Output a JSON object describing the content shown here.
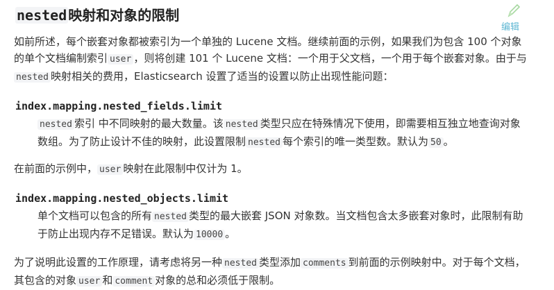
{
  "title": {
    "code": "nested",
    "text": "映射和对象的限制"
  },
  "edit_label": "编辑",
  "intro": {
    "t1": "如前所述，每个嵌套对象都被索引为一个单独的 Lucene 文档。继续前面的示例，如果我们为包含 100 个对象的单个文档编制索引",
    "c1": "user",
    "t2": "，则将创建 101 个 Lucene 文档：一个用于父文档，一个用于每个嵌套对象。由于与",
    "c2": "nested",
    "t3": "映射相关的费用，Elasticsearch 设置了适当的设置以防止出现性能问题："
  },
  "setting1": {
    "name": "index.mapping.nested_fields.limit",
    "c1": "nested",
    "t1": "索引 中不同映射的最大数量。该",
    "c2": "nested",
    "t2": "类型只应在特殊情况下使用，即需要相互独立地查询对象数组。为了防止设计不佳的映射，此设置限制",
    "c3": "nested",
    "t3": "每个索引的唯一类型数。默认为",
    "c4": "50",
    "t4": "。"
  },
  "note": {
    "t1": "在前面的示例中，",
    "c1": "user",
    "t2": "映射在此限制中仅计为 1。"
  },
  "setting2": {
    "name": "index.mapping.nested_objects.limit",
    "t1": "单个文档可以包含的所有",
    "c1": "nested",
    "t2": "类型的最大嵌套 JSON 对象数。当文档包含太多嵌套对象时，此限制有助于防止出现内存不足错误。默认为",
    "c2": "10000",
    "t3": "。"
  },
  "closing": {
    "t1": "为了说明此设置的工作原理，请考虑将另一种",
    "c1": "nested",
    "t2": "类型添加",
    "c2": "comments",
    "t3": "到前面的示例映射中。对于每个文档，其包含的对象",
    "c3": "user",
    "t4": "和",
    "c4": "comment",
    "t5": "对象的总和必须低于限制。"
  }
}
